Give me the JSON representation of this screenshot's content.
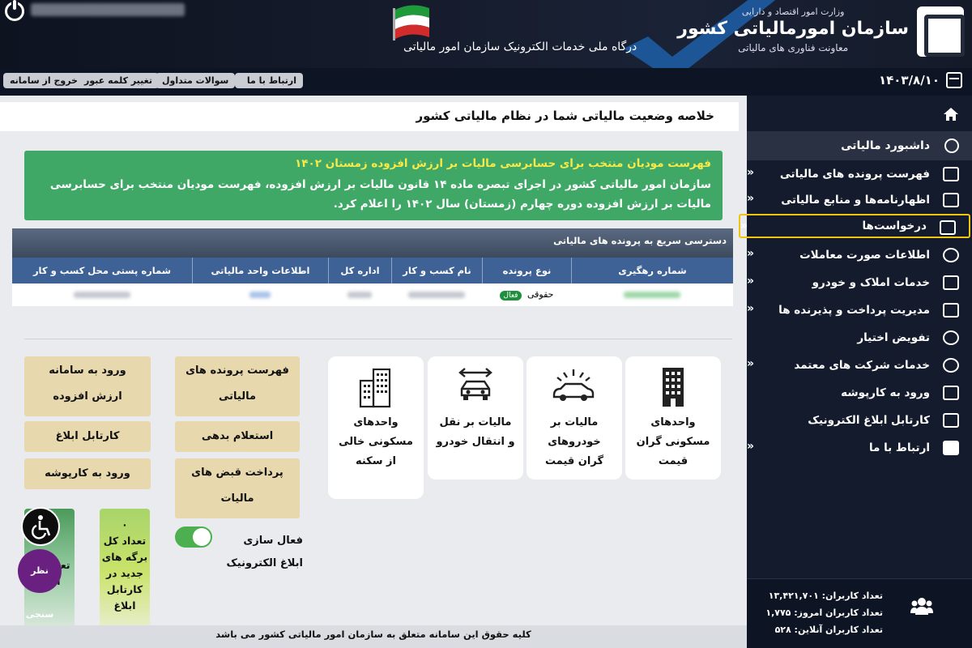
{
  "header": {
    "ministry": "وزارت امور اقتصاد و دارایی",
    "org_name": "سازمان امورمالیاتی کشور",
    "deputy": "معاونت فناوری های مالیاتی",
    "portal_title": "درگاه ملی خدمات الکترونیک سازمان امور مالیاتی"
  },
  "toolbar": {
    "logout": "خروج از سامانه",
    "change_password": "تغییر کلمه عبور",
    "faq": "سوالات متداول",
    "contact": "ارتباط با ما",
    "date": "۱۴۰۳/۸/۱۰"
  },
  "sidebar": {
    "dashboard": "داشبورد مالیاتی",
    "items": [
      {
        "label": "فهرست پرونده های مالیاتی",
        "chevron": "»"
      },
      {
        "label": "اظهارنامه‌ها و منابع مالیاتی",
        "chevron": "»"
      },
      {
        "label": "درخواست‌ها",
        "chevron": "»"
      },
      {
        "label": "اطلاعات صورت معاملات",
        "chevron": "»"
      },
      {
        "label": "خدمات املاک و خودرو",
        "chevron": "»"
      },
      {
        "label": "مدیریت پرداخت و پذیرنده ها",
        "chevron": "»"
      },
      {
        "label": "تفویض اختیار",
        "chevron": ""
      },
      {
        "label": "خدمات شرکت های معتمد",
        "chevron": "»"
      },
      {
        "label": "ورود به کارپوشه",
        "chevron": ""
      },
      {
        "label": "کارتابل ابلاغ الکترونیک",
        "chevron": ""
      },
      {
        "label": "ارتباط با ما",
        "chevron": "»"
      }
    ],
    "stats": {
      "total": "تعداد کاربران: ۱۳,۴۲۱,۷۰۱",
      "today": "تعداد کاربران امروز: ۱,۷۷۵",
      "online": "تعداد کاربران آنلاین: ۵۲۸"
    }
  },
  "main": {
    "title": "خلاصه وضعیت مالیاتی شما در نظام مالیاتی کشور",
    "alert": {
      "title": "فهرست مودیان منتخب برای حسابرسی مالیات بر ارزش افزوده زمستان ۱۴۰۲",
      "body": "سازمان امور مالیاتی کشور در اجرای تبصره ماده ۱۴ قانون مالیات بر ارزش افزوده، فهرست مودیان منتخب برای حسابرسی مالیات بر ارزش افزوده دوره چهارم (زمستان) سال ۱۴۰۲ را اعلام کرد."
    },
    "quick_access": {
      "title": "دسترسی سریع به پرونده های مالیاتی",
      "columns": [
        "شماره رهگیری",
        "نوع پرونده",
        "نام کسب و کار",
        "اداره کل",
        "اطلاعات واحد مالیاتی",
        "شماره پستی محل کسب و کار"
      ],
      "row": {
        "type": "حقوقی",
        "status": "فعال"
      }
    },
    "services": [
      "واحدهای مسکونی گران قیمت",
      "مالیات بر خودروهای گران قیمت",
      "مالیات بر نقل و انتقال خودرو",
      "واحدهای مسکونی خالی از سکنه"
    ],
    "links_col1": {
      "tax_files": "فهرست پرونده های مالیاتی",
      "debt_inquiry": "استعلام بدهی مالیاتی",
      "pay_bills": "پرداخت قبض های مالیات"
    },
    "links_col2": {
      "vat_login": "ورود به سامانه ارزش افزوده",
      "notice_cartable": "کارتابل ابلاغ الکترونیک",
      "workfolder": "ورود به کارپوشه"
    },
    "toggle_label": "فعال سازی ابلاغ الکترونیک",
    "stat_card_green": {
      "count": "۰",
      "label": "تعداد کل برگه های جدید در کارتابل ابلاغ"
    },
    "stat_card_partial": {
      "label": "تعد... در ابلاغ"
    },
    "poll_label": "نظر سنجی",
    "footer": "کلیه حقوق این سامانه متعلق به سازمان امور مالیاتی کشور می باشد"
  },
  "colors": {
    "header_bg": "#141a28",
    "sidebar_bg": "#141b2c",
    "alert_green": "#3fa866",
    "table_header": "#3e6196",
    "tan_button": "#e8d8ad",
    "highlight": "#f1c40f"
  }
}
